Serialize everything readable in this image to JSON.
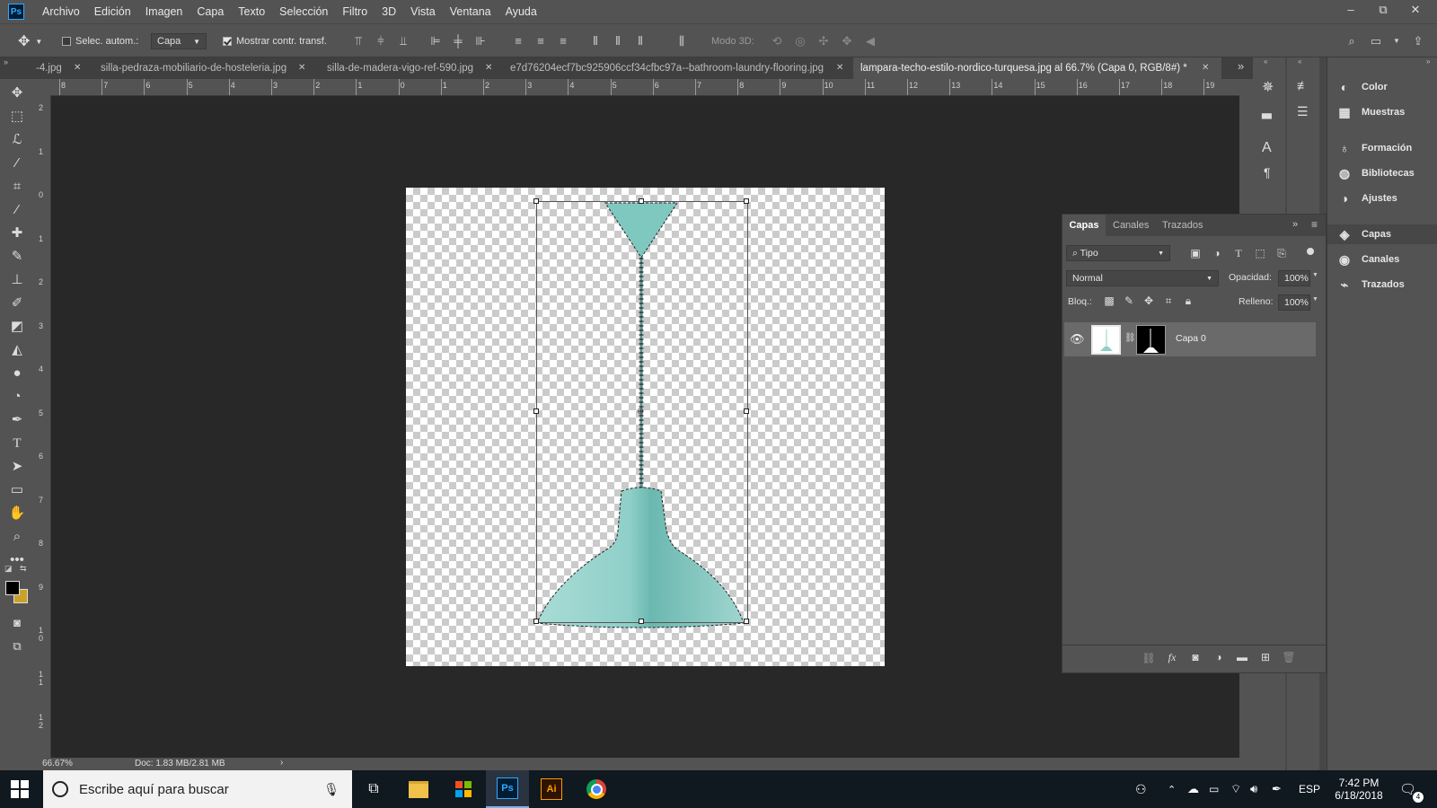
{
  "app": {
    "logo": "Ps"
  },
  "menu": [
    "Archivo",
    "Edición",
    "Imagen",
    "Capa",
    "Texto",
    "Selección",
    "Filtro",
    "3D",
    "Vista",
    "Ventana",
    "Ayuda"
  ],
  "window_controls": {
    "minimize": "–",
    "restore": "⧉",
    "close": "✕"
  },
  "options": {
    "auto_select_label": "Selec. autom.:",
    "auto_select_checked": false,
    "auto_select_target": "Capa",
    "show_transform_label": "Mostrar contr. transf.",
    "show_transform_checked": true,
    "mode3d_label": "Modo 3D:"
  },
  "tabs": [
    {
      "label": "-4.jpg",
      "close": "✕"
    },
    {
      "label": "silla-pedraza-mobiliario-de-hosteleria.jpg",
      "close": "✕"
    },
    {
      "label": "silla-de-madera-vigo-ref-590.jpg",
      "close": "✕"
    },
    {
      "label": "e7d76204ecf7bc925906ccf34cfbc97a--bathroom-laundry-flooring.jpg",
      "close": "✕"
    },
    {
      "label": "lampara-techo-estilo-nordico-turquesa.jpg al 66.7% (Capa 0, RGB/8#) *",
      "close": "✕",
      "active": true
    }
  ],
  "tabs_overflow": "»",
  "ruler_h": [
    "8",
    "7",
    "6",
    "5",
    "4",
    "3",
    "2",
    "1",
    "0",
    "1",
    "2",
    "3",
    "4",
    "5",
    "6",
    "7",
    "8",
    "9",
    "10",
    "11",
    "12",
    "13",
    "14",
    "15",
    "16",
    "17",
    "18",
    "19"
  ],
  "ruler_v": [
    "2",
    "1",
    "0",
    "1",
    "2",
    "3",
    "4",
    "5",
    "6",
    "7",
    "8",
    "9",
    "1 0",
    "1 1",
    "1 2"
  ],
  "status": {
    "zoom": "66.67%",
    "doc": "Doc: 1.83 MB/2.81 MB",
    "arrow": "›"
  },
  "right_panel": {
    "items": [
      {
        "label": "Color",
        "icon": "color-icon"
      },
      {
        "label": "Muestras",
        "icon": "swatches-icon"
      },
      {
        "label": "Formación",
        "icon": "learn-icon"
      },
      {
        "label": "Bibliotecas",
        "icon": "libraries-icon"
      },
      {
        "label": "Ajustes",
        "icon": "adjustments-icon"
      },
      {
        "label": "Capas",
        "icon": "layers-icon",
        "selected": true
      },
      {
        "label": "Canales",
        "icon": "channels-icon"
      },
      {
        "label": "Trazados",
        "icon": "paths-icon"
      }
    ]
  },
  "layers_panel": {
    "tabs": [
      "Capas",
      "Canales",
      "Trazados"
    ],
    "filter_label": "Tipo",
    "blend_mode": "Normal",
    "opacity_label": "Opacidad:",
    "opacity_value": "100%",
    "lock_label": "Bloq.:",
    "fill_label": "Relleno:",
    "fill_value": "100%",
    "layers": [
      {
        "name": "Capa 0",
        "visible": true
      }
    ]
  },
  "taskbar": {
    "search_placeholder": "Escribe aquí para buscar",
    "apps": [
      "task-view",
      "file-explorer",
      "store",
      "photoshop",
      "illustrator",
      "chrome"
    ],
    "lang": "ESP",
    "time": "7:42 PM",
    "date": "6/18/2018",
    "notifications": "4"
  },
  "colors": {
    "foreground": "#000000",
    "background": "#c9a227",
    "lamp": "#8fcfc8",
    "accent": "#31a8ff"
  }
}
